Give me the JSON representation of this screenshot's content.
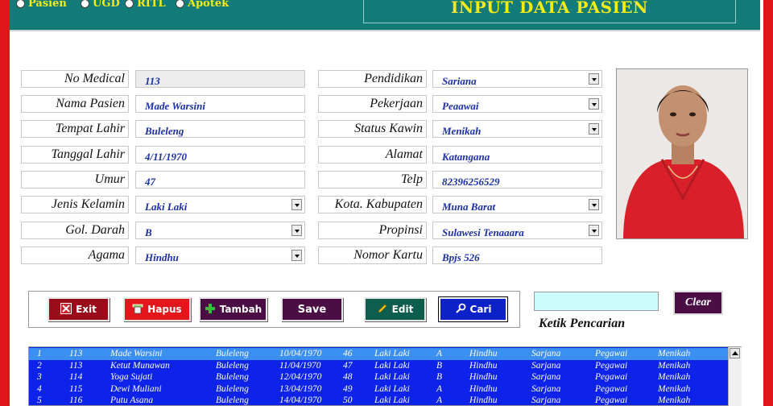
{
  "nav": {
    "options": [
      {
        "label": "Pasien",
        "selected": true
      },
      {
        "label": "UGD",
        "selected": false
      },
      {
        "label": "RITL",
        "selected": false
      },
      {
        "label": "Apotek",
        "selected": false
      }
    ]
  },
  "header": {
    "title": "INPUT DATA PASIEN"
  },
  "form_left": [
    {
      "label": "No Medical",
      "value": "113",
      "kind": "readonly"
    },
    {
      "label": "Nama Pasien",
      "value": "Made Warsini",
      "kind": "text"
    },
    {
      "label": "Tempat Lahir",
      "value": "Buleleng",
      "kind": "text"
    },
    {
      "label": "Tanggal Lahir",
      "value": "4/11/1970",
      "kind": "text"
    },
    {
      "label": "Umur",
      "value": "47",
      "kind": "text"
    },
    {
      "label": "Jenis Kelamin",
      "value": "Laki Laki",
      "kind": "combo"
    },
    {
      "label": "Gol. Darah",
      "value": "B",
      "kind": "combo"
    },
    {
      "label": "Agama",
      "value": "Hindhu",
      "kind": "combo"
    }
  ],
  "form_right": [
    {
      "label": "Pendidikan",
      "value": "Sariana",
      "kind": "combo"
    },
    {
      "label": "Pekerjaan",
      "value": "Peaawai",
      "kind": "combo"
    },
    {
      "label": "Status Kawin",
      "value": "Menikah",
      "kind": "combo"
    },
    {
      "label": "Alamat",
      "value": "Katangana",
      "kind": "text"
    },
    {
      "label": "Telp",
      "value": "82396256529",
      "kind": "text"
    },
    {
      "label": "Kota. Kabupaten",
      "value": "Muna Barat",
      "kind": "combo"
    },
    {
      "label": "Propinsi",
      "value": "Sulawesi Tenaaara",
      "kind": "combo"
    },
    {
      "label": "Nomor Kartu",
      "value": "Bpjs 526",
      "kind": "text"
    }
  ],
  "buttons": {
    "exit": {
      "label": "Exit",
      "color": "#9a0c1a",
      "icon": "close-icon"
    },
    "hapus": {
      "label": "Hapus",
      "color": "#e4161c",
      "icon": "trash-icon"
    },
    "tambah": {
      "label": "Tambah",
      "color": "#4a0e44",
      "icon": "plus-icon"
    },
    "save": {
      "label": "Save",
      "color": "#4a0e44",
      "icon": ""
    },
    "edit": {
      "label": "Edit",
      "color": "#0d5e4d",
      "icon": "pencil-icon"
    },
    "cari": {
      "label": "Cari",
      "color": "#0c21c8",
      "icon": "search-icon"
    }
  },
  "search": {
    "value": "",
    "hint": "Ketik Pencarian",
    "clear_label": "Clear"
  },
  "table": {
    "rows": [
      [
        "1",
        "113",
        "Made Warsini",
        "Buleleng",
        "10/04/1970",
        "46",
        "Laki Laki",
        "A",
        "Hindhu",
        "Sarjana",
        "Pegawai",
        "Menikah"
      ],
      [
        "2",
        "113",
        "Ketut Munawan",
        "Buleleng",
        "11/04/1970",
        "47",
        "Laki Laki",
        "B",
        "Hindhu",
        "Sarjana",
        "Pegawai",
        "Menikah"
      ],
      [
        "3",
        "114",
        "Yoga Sujati",
        "Buleleng",
        "12/04/1970",
        "48",
        "Laki Laki",
        "B",
        "Hindhu",
        "Sarjana",
        "Pegawai",
        "Menikah"
      ],
      [
        "4",
        "115",
        "Dewi Muliani",
        "Buleleng",
        "13/04/1970",
        "49",
        "Laki Laki",
        "A",
        "Hindhu",
        "Sarjana",
        "Pegawai",
        "Menikah"
      ],
      [
        "5",
        "116",
        "Putu Asana",
        "Buleleng",
        "14/04/1970",
        "50",
        "Laki Laki",
        "A",
        "Hindhu",
        "Sarjana",
        "Pegawai",
        "Menikah"
      ]
    ],
    "selected_index": 0
  },
  "colors": {
    "frame": "#e0161a",
    "header": "#137b78",
    "title_text": "#f7ec12",
    "field_text": "#1b2fa8",
    "list_bg": "#0d23ea",
    "list_selected": "#3b8ff0"
  }
}
